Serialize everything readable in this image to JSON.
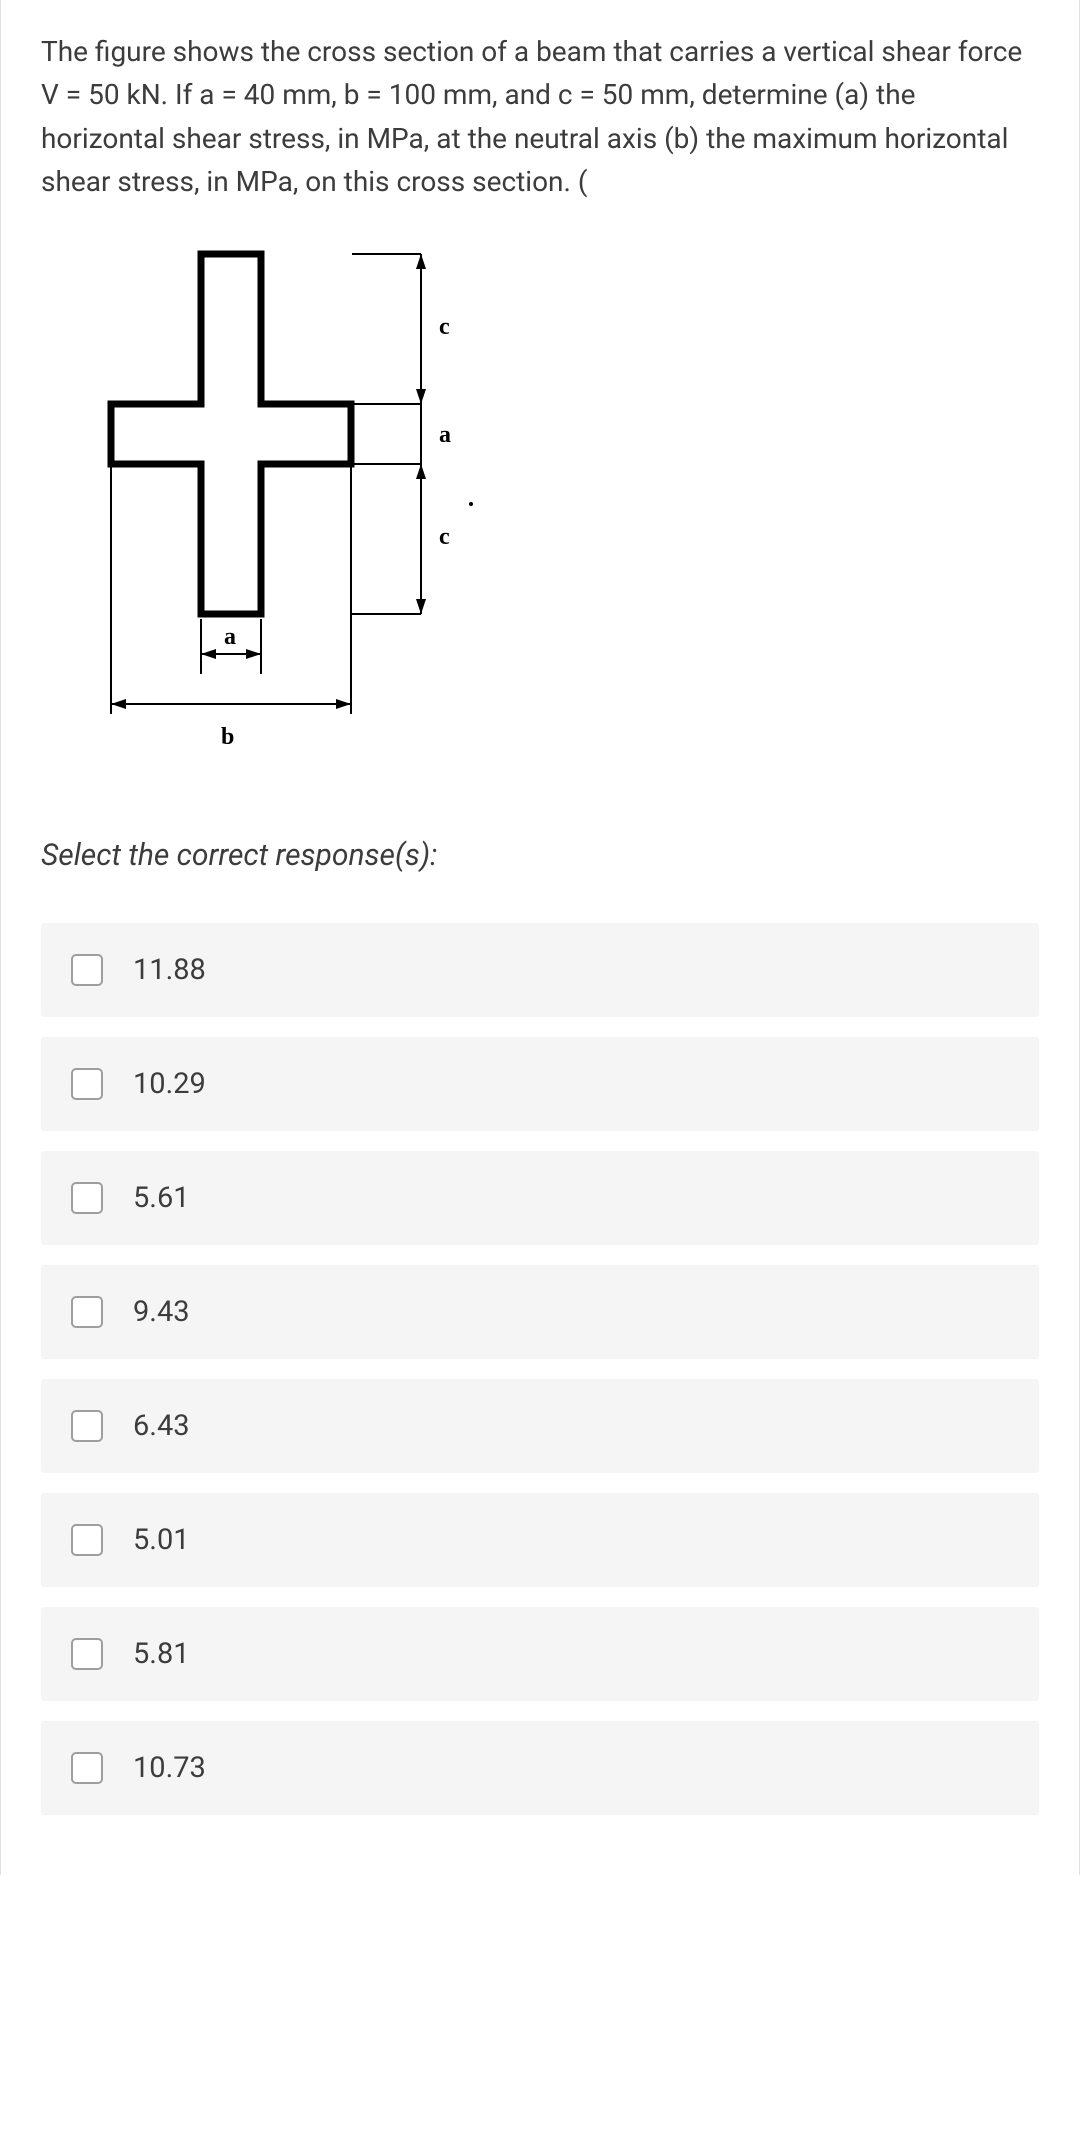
{
  "question": {
    "text": "The figure shows the cross section of a beam that carries a vertical shear force V = 50 kN. If a = 40 mm, b = 100 mm, and c = 50 mm, determine (a) the horizontal shear stress, in MPa, at the neutral axis (b) the maximum horizontal shear stress, in MPa, on this cross section. (",
    "select_prompt": "Select the correct response(s):",
    "figure": {
      "labels": {
        "c_top": "c",
        "a_mid": "a",
        "c_bot": "c",
        "a_bottom": "a",
        "b_bottom": "b"
      }
    },
    "options": [
      "11.88",
      "10.29",
      "5.61",
      "9.43",
      "6.43",
      "5.01",
      "5.81",
      "10.73"
    ]
  }
}
